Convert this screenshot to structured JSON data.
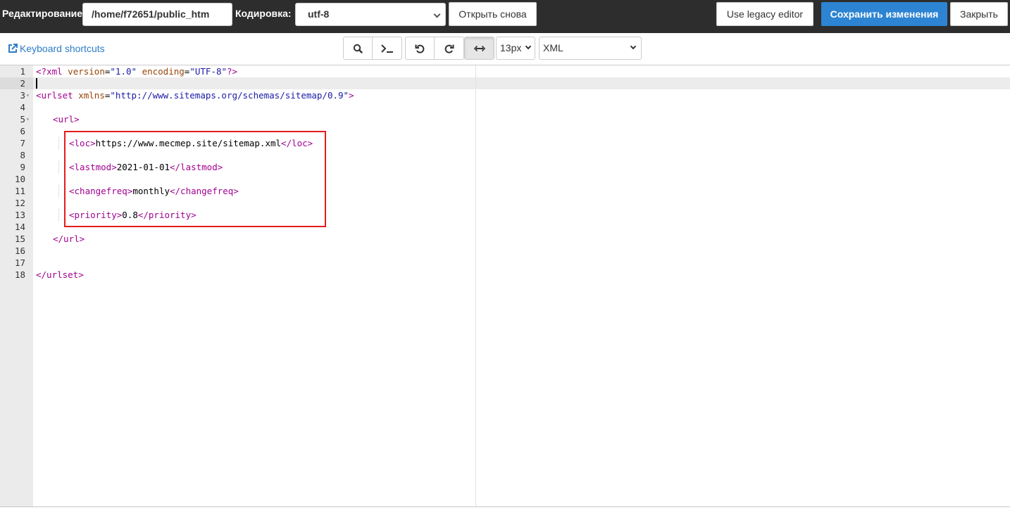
{
  "topbar": {
    "editing_label": "Редактирование:",
    "path_value": "/home/f72651/public_htm",
    "encoding_label": "Кодировка:",
    "encoding_value": "utf-8",
    "reopen_label": "Открыть снова",
    "legacy_label": "Use legacy editor",
    "save_label": "Сохранить изменения",
    "close_label": "Закрыть",
    "save_color": "#2d84d2"
  },
  "toolbar": {
    "keyboard_shortcuts": "Keyboard shortcuts",
    "buttons": [
      {
        "icon": "search-icon",
        "glyph": "search"
      },
      {
        "icon": "terminal-icon",
        "glyph": "terminal"
      },
      {
        "icon": "undo-icon",
        "glyph": "undo"
      },
      {
        "icon": "redo-icon",
        "glyph": "redo"
      },
      {
        "icon": "wrap-icon",
        "glyph": "wrap",
        "active": true
      }
    ],
    "font_size": "13px",
    "mode": "XML"
  },
  "editor": {
    "current_line": 2,
    "line_numbers": [
      "1",
      "2",
      "3",
      "4",
      "5",
      "6",
      "7",
      "8",
      "9",
      "10",
      "11",
      "12",
      "13",
      "14",
      "15",
      "16",
      "17",
      "18"
    ],
    "fold_lines": [
      3,
      5
    ],
    "lines": {
      "l1": {
        "p1": "<?",
        "p2": "xml",
        "p3": " ",
        "p4": "version",
        "p5": "=",
        "p6": "\"1.0\"",
        "p7": " ",
        "p8": "encoding",
        "p9": "=",
        "p10": "\"UTF-8\"",
        "p11": "?>"
      },
      "l3": {
        "p1": "<urlset",
        "p2": " ",
        "p3": "xmlns",
        "p4": "=",
        "p5": "\"http://www.sitemaps.org/schemas/sitemap/0.9\"",
        "p6": ">"
      },
      "l5": {
        "open": "<url>"
      },
      "l7": {
        "open": "<loc>",
        "text": "https://www.mecmep.site/sitemap.xml",
        "close": "</loc>"
      },
      "l9": {
        "open": "<lastmod>",
        "text": "2021-01-01",
        "close": "</lastmod>"
      },
      "l11": {
        "open": "<changefreq>",
        "text": "monthly",
        "close": "</changefreq>"
      },
      "l13": {
        "open": "<priority>",
        "text": "0.8",
        "close": "</priority>"
      },
      "l15": {
        "close": "</url>"
      },
      "l18": {
        "close": "</urlset>"
      }
    },
    "highlight_box_color": "#e41c1c"
  }
}
